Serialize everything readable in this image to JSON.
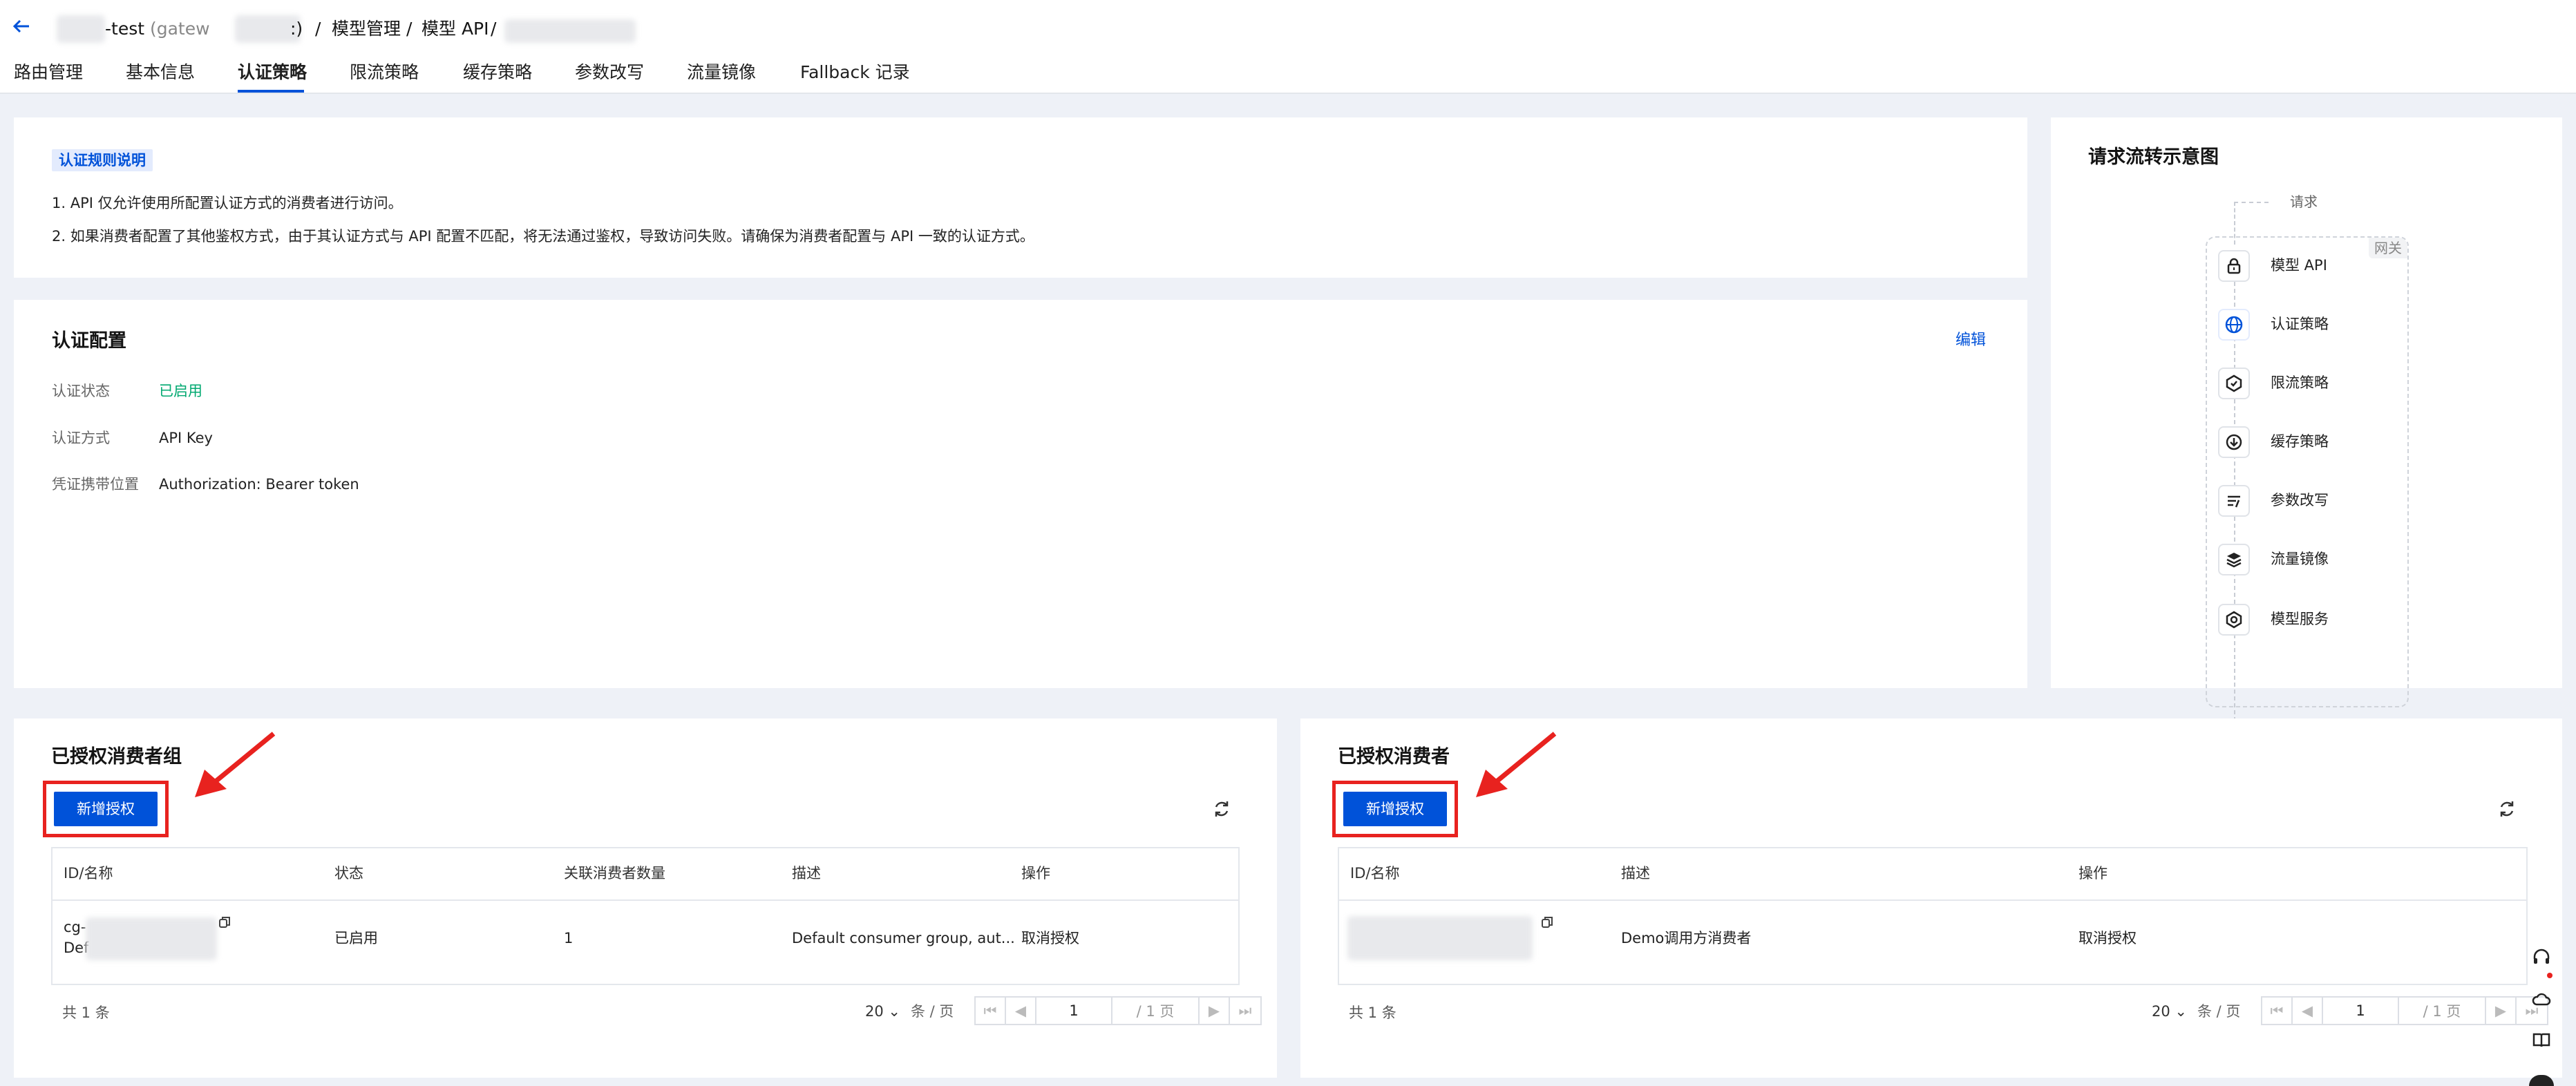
{
  "header": {
    "back_icon": "arrow-left-icon",
    "crumb_instance": "-test",
    "crumb_instance_id_prefix": "(gatew",
    "crumb_instance_id_suffix": ":)",
    "sep": "/",
    "crumb_model_mgmt": "模型管理",
    "crumb_model_api": "模型 API"
  },
  "tabs": [
    "路由管理",
    "基本信息",
    "认证策略",
    "限流策略",
    "缓存策略",
    "参数改写",
    "流量镜像",
    "Fallback 记录"
  ],
  "active_tab": "认证策略",
  "auth_rules": {
    "tag": "认证规则说明",
    "line1": "1. API 仅允许使用所配置认证方式的消费者进行访问。",
    "line2": "2. 如果消费者配置了其他鉴权方式，由于其认证方式与 API 配置不匹配，将无法通过鉴权，导致访问失败。请确保为消费者配置与 API 一致的认证方式。"
  },
  "auth_config": {
    "title": "认证配置",
    "edit": "编辑",
    "status_label": "认证状态",
    "status_value": "已启用",
    "method_label": "认证方式",
    "method_value": "API Key",
    "location_label": "凭证携带位置",
    "location_value": "Authorization: Bearer token"
  },
  "flow": {
    "title": "请求流转示意图",
    "request": "请求",
    "gateway": "网关",
    "steps": [
      {
        "label": "模型 API",
        "icon": "lock-icon"
      },
      {
        "label": "认证策略",
        "icon": "globe-icon"
      },
      {
        "label": "限流策略",
        "icon": "rate-limit-icon"
      },
      {
        "label": "缓存策略",
        "icon": "download-circle-icon"
      },
      {
        "label": "参数改写",
        "icon": "rewrite-lines-icon"
      },
      {
        "label": "流量镜像",
        "icon": "layers-icon"
      }
    ],
    "service": {
      "label": "模型服务",
      "icon": "model-service-icon"
    }
  },
  "groups": {
    "title": "已授权消费者组",
    "add_button": "新增授权",
    "columns": [
      "ID/名称",
      "状态",
      "关联消费者数量",
      "描述",
      "操作"
    ],
    "row": {
      "id_prefix": "cg-",
      "name_prefix": "Def",
      "status": "已启用",
      "count": "1",
      "desc": "Default consumer group, aut...",
      "action": "取消授权"
    },
    "total": "共 1 条",
    "page_size": "20",
    "page_unit": "条 / 页",
    "page": "1",
    "page_total": "/ 1 页"
  },
  "consumers": {
    "title": "已授权消费者",
    "add_button": "新增授权",
    "columns": [
      "ID/名称",
      "描述",
      "操作"
    ],
    "row": {
      "desc": "Demo调用方消费者",
      "action": "取消授权"
    },
    "total": "共 1 条",
    "page_size": "20",
    "page_unit": "条 / 页",
    "page": "1",
    "page_total": "/ 1 页"
  },
  "colors": {
    "primary": "#0052d9",
    "success": "#00a870",
    "highlight": "#e8221f"
  }
}
